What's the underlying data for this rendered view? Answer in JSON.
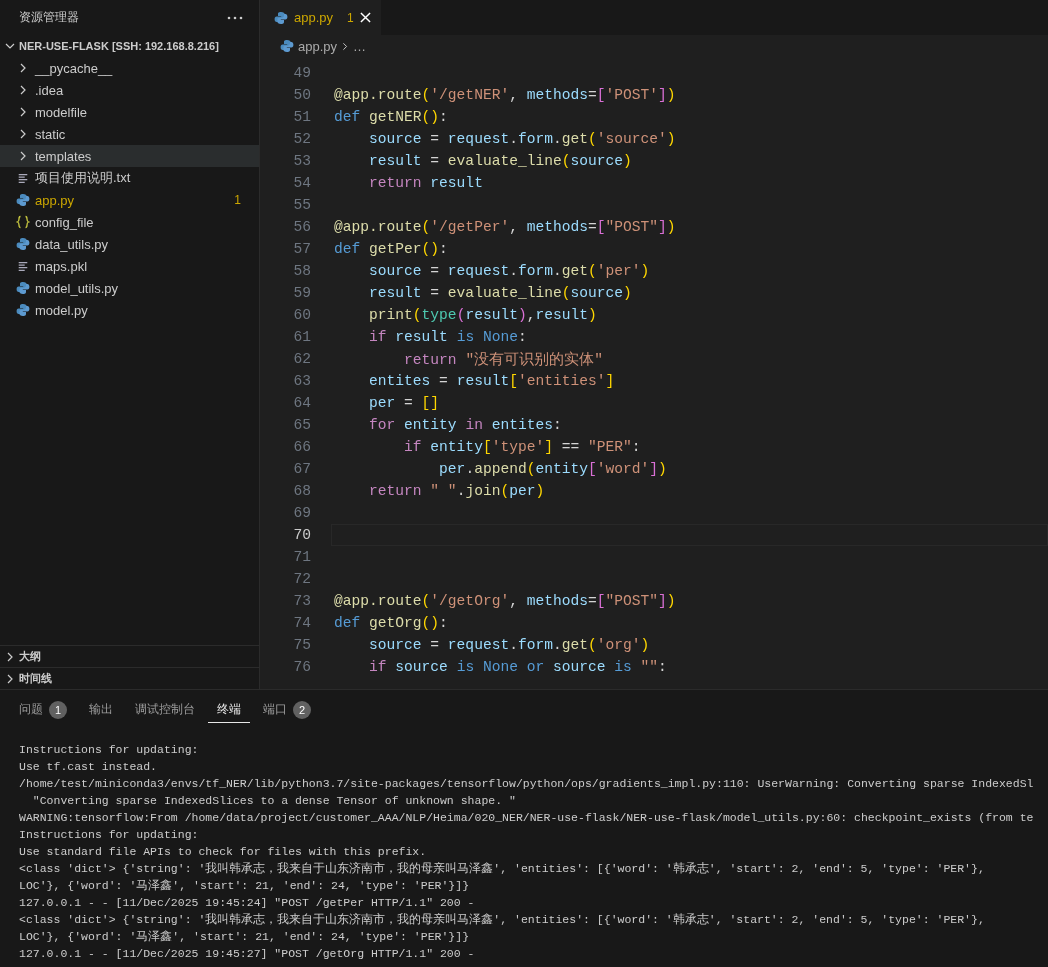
{
  "explorer": {
    "title": "资源管理器",
    "root": {
      "label": "NER-USE-FLASK [SSH: 192.168.8.216]",
      "expanded": true,
      "children": [
        {
          "label": "__pycache__",
          "kind": "folder",
          "expanded": false,
          "highlighted": false,
          "modified": false
        },
        {
          "label": ".idea",
          "kind": "folder",
          "expanded": false,
          "highlighted": false,
          "modified": false
        },
        {
          "label": "modelfile",
          "kind": "folder",
          "expanded": false,
          "highlighted": false,
          "modified": false
        },
        {
          "label": "static",
          "kind": "folder",
          "expanded": false,
          "highlighted": false,
          "modified": false
        },
        {
          "label": "templates",
          "kind": "folder",
          "expanded": false,
          "highlighted": true,
          "modified": false
        },
        {
          "label": "项目使用说明.txt",
          "kind": "text",
          "highlighted": false,
          "modified": false
        },
        {
          "label": "app.py",
          "kind": "python",
          "highlighted": false,
          "modified": true,
          "badge": "1"
        },
        {
          "label": "config_file",
          "kind": "json",
          "highlighted": false,
          "modified": false
        },
        {
          "label": "data_utils.py",
          "kind": "python",
          "highlighted": false,
          "modified": false
        },
        {
          "label": "maps.pkl",
          "kind": "text",
          "highlighted": false,
          "modified": false
        },
        {
          "label": "model_utils.py",
          "kind": "python",
          "highlighted": false,
          "modified": false
        },
        {
          "label": "model.py",
          "kind": "python",
          "highlighted": false,
          "modified": false
        }
      ]
    },
    "sections": [
      {
        "label": "大纲",
        "expanded": false
      },
      {
        "label": "时间线",
        "expanded": false
      }
    ]
  },
  "tabs": [
    {
      "label": "app.py",
      "badge": "1",
      "selected": true,
      "modified": true
    }
  ],
  "breadcrumb": {
    "file": "app.py",
    "more": "…"
  },
  "editor": {
    "lines": [
      {
        "number": "49",
        "current": false
      },
      {
        "number": "50",
        "current": false,
        "tokens": [
          {
            "t": "@app.route",
            "kind": "fn"
          },
          {
            "t": "(",
            "kind": "b1"
          },
          {
            "t": "'/getNER'",
            "kind": "str"
          },
          {
            "t": ", ",
            "kind": "p"
          },
          {
            "t": "methods",
            "kind": "var"
          },
          {
            "t": "=",
            "kind": "p"
          },
          {
            "t": "[",
            "kind": "b2"
          },
          {
            "t": "'POST'",
            "kind": "str"
          },
          {
            "t": "]",
            "kind": "b2"
          },
          {
            "t": ")",
            "kind": "b1"
          }
        ]
      },
      {
        "number": "51",
        "current": false,
        "tokens": [
          {
            "t": "def ",
            "kind": "bl"
          },
          {
            "t": "getNER",
            "kind": "fn"
          },
          {
            "t": "()",
            "kind": "b1"
          },
          {
            "t": ":",
            "kind": "p"
          }
        ]
      },
      {
        "number": "52",
        "current": false,
        "tokens": [
          {
            "t": "    source",
            "kind": "var"
          },
          {
            "t": " = ",
            "kind": "p"
          },
          {
            "t": "request",
            "kind": "var"
          },
          {
            "t": ".",
            "kind": "p"
          },
          {
            "t": "form",
            "kind": "var"
          },
          {
            "t": ".",
            "kind": "p"
          },
          {
            "t": "get",
            "kind": "fn"
          },
          {
            "t": "(",
            "kind": "b1"
          },
          {
            "t": "'source'",
            "kind": "str"
          },
          {
            "t": ")",
            "kind": "b1"
          }
        ]
      },
      {
        "number": "53",
        "current": false,
        "tokens": [
          {
            "t": "    result",
            "kind": "var"
          },
          {
            "t": " = ",
            "kind": "p"
          },
          {
            "t": "evaluate_line",
            "kind": "fn"
          },
          {
            "t": "(",
            "kind": "b1"
          },
          {
            "t": "source",
            "kind": "var"
          },
          {
            "t": ")",
            "kind": "b1"
          }
        ]
      },
      {
        "number": "54",
        "current": false,
        "tokens": [
          {
            "t": "    return ",
            "kind": "kw"
          },
          {
            "t": "result",
            "kind": "var"
          }
        ]
      },
      {
        "number": "55",
        "current": false
      },
      {
        "number": "56",
        "current": false,
        "tokens": [
          {
            "t": "@app.route",
            "kind": "fn"
          },
          {
            "t": "(",
            "kind": "b1"
          },
          {
            "t": "'/getPer'",
            "kind": "str"
          },
          {
            "t": ", ",
            "kind": "p"
          },
          {
            "t": "methods",
            "kind": "var"
          },
          {
            "t": "=",
            "kind": "p"
          },
          {
            "t": "[",
            "kind": "b2"
          },
          {
            "t": "\"POST\"",
            "kind": "str"
          },
          {
            "t": "]",
            "kind": "b2"
          },
          {
            "t": ")",
            "kind": "b1"
          }
        ]
      },
      {
        "number": "57",
        "current": false,
        "tokens": [
          {
            "t": "def ",
            "kind": "bl"
          },
          {
            "t": "getPer",
            "kind": "fn"
          },
          {
            "t": "()",
            "kind": "b1"
          },
          {
            "t": ":",
            "kind": "p"
          }
        ]
      },
      {
        "number": "58",
        "current": false,
        "tokens": [
          {
            "t": "    source",
            "kind": "var"
          },
          {
            "t": " = ",
            "kind": "p"
          },
          {
            "t": "request",
            "kind": "var"
          },
          {
            "t": ".",
            "kind": "p"
          },
          {
            "t": "form",
            "kind": "var"
          },
          {
            "t": ".",
            "kind": "p"
          },
          {
            "t": "get",
            "kind": "fn"
          },
          {
            "t": "(",
            "kind": "b1"
          },
          {
            "t": "'per'",
            "kind": "str"
          },
          {
            "t": ")",
            "kind": "b1"
          }
        ]
      },
      {
        "number": "59",
        "current": false,
        "tokens": [
          {
            "t": "    result",
            "kind": "var"
          },
          {
            "t": " = ",
            "kind": "p"
          },
          {
            "t": "evaluate_line",
            "kind": "fn"
          },
          {
            "t": "(",
            "kind": "b1"
          },
          {
            "t": "source",
            "kind": "var"
          },
          {
            "t": ")",
            "kind": "b1"
          }
        ]
      },
      {
        "number": "60",
        "current": false,
        "tokens": [
          {
            "t": "    print",
            "kind": "fn"
          },
          {
            "t": "(",
            "kind": "b1"
          },
          {
            "t": "type",
            "kind": "cls"
          },
          {
            "t": "(",
            "kind": "b2"
          },
          {
            "t": "result",
            "kind": "var"
          },
          {
            "t": ")",
            "kind": "b2"
          },
          {
            "t": ",",
            "kind": "p"
          },
          {
            "t": "result",
            "kind": "var"
          },
          {
            "t": ")",
            "kind": "b1"
          }
        ]
      },
      {
        "number": "61",
        "current": false,
        "tokens": [
          {
            "t": "    if ",
            "kind": "kw"
          },
          {
            "t": "result ",
            "kind": "var"
          },
          {
            "t": "is None",
            "kind": "bl"
          },
          {
            "t": ":",
            "kind": "p"
          }
        ]
      },
      {
        "number": "62",
        "current": false,
        "tokens": [
          {
            "t": "        return ",
            "kind": "kw"
          },
          {
            "t": "\"没有可识别的实体\"",
            "kind": "str"
          }
        ]
      },
      {
        "number": "63",
        "current": false,
        "tokens": [
          {
            "t": "    entites",
            "kind": "var"
          },
          {
            "t": " = ",
            "kind": "p"
          },
          {
            "t": "result",
            "kind": "var"
          },
          {
            "t": "[",
            "kind": "b1"
          },
          {
            "t": "'entities'",
            "kind": "str"
          },
          {
            "t": "]",
            "kind": "b1"
          }
        ]
      },
      {
        "number": "64",
        "current": false,
        "tokens": [
          {
            "t": "    per",
            "kind": "var"
          },
          {
            "t": " = ",
            "kind": "p"
          },
          {
            "t": "[]",
            "kind": "b1"
          }
        ]
      },
      {
        "number": "65",
        "current": false,
        "tokens": [
          {
            "t": "    for ",
            "kind": "kw"
          },
          {
            "t": "entity ",
            "kind": "var"
          },
          {
            "t": "in ",
            "kind": "kw"
          },
          {
            "t": "entites",
            "kind": "var"
          },
          {
            "t": ":",
            "kind": "p"
          }
        ]
      },
      {
        "number": "66",
        "current": false,
        "tokens": [
          {
            "t": "        if ",
            "kind": "kw"
          },
          {
            "t": "entity",
            "kind": "var"
          },
          {
            "t": "[",
            "kind": "b1"
          },
          {
            "t": "'type'",
            "kind": "str"
          },
          {
            "t": "]",
            "kind": "b1"
          },
          {
            "t": " == ",
            "kind": "p"
          },
          {
            "t": "\"PER\"",
            "kind": "str"
          },
          {
            "t": ":",
            "kind": "p"
          }
        ]
      },
      {
        "number": "67",
        "current": false,
        "tokens": [
          {
            "t": "            per",
            "kind": "var"
          },
          {
            "t": ".",
            "kind": "p"
          },
          {
            "t": "append",
            "kind": "fn"
          },
          {
            "t": "(",
            "kind": "b1"
          },
          {
            "t": "entity",
            "kind": "var"
          },
          {
            "t": "[",
            "kind": "b2"
          },
          {
            "t": "'word'",
            "kind": "str"
          },
          {
            "t": "]",
            "kind": "b2"
          },
          {
            "t": ")",
            "kind": "b1"
          }
        ]
      },
      {
        "number": "68",
        "current": false,
        "tokens": [
          {
            "t": "    return ",
            "kind": "kw"
          },
          {
            "t": "\" \"",
            "kind": "str"
          },
          {
            "t": ".",
            "kind": "p"
          },
          {
            "t": "join",
            "kind": "fn"
          },
          {
            "t": "(",
            "kind": "b1"
          },
          {
            "t": "per",
            "kind": "var"
          },
          {
            "t": ")",
            "kind": "b1"
          }
        ]
      },
      {
        "number": "69",
        "current": false
      },
      {
        "number": "70",
        "current": true
      },
      {
        "number": "71",
        "current": false
      },
      {
        "number": "72",
        "current": false
      },
      {
        "number": "73",
        "current": false,
        "tokens": [
          {
            "t": "@app.route",
            "kind": "fn"
          },
          {
            "t": "(",
            "kind": "b1"
          },
          {
            "t": "'/getOrg'",
            "kind": "str"
          },
          {
            "t": ", ",
            "kind": "p"
          },
          {
            "t": "methods",
            "kind": "var"
          },
          {
            "t": "=",
            "kind": "p"
          },
          {
            "t": "[",
            "kind": "b2"
          },
          {
            "t": "\"POST\"",
            "kind": "str"
          },
          {
            "t": "]",
            "kind": "b2"
          },
          {
            "t": ")",
            "kind": "b1"
          }
        ]
      },
      {
        "number": "74",
        "current": false,
        "tokens": [
          {
            "t": "def ",
            "kind": "bl"
          },
          {
            "t": "getOrg",
            "kind": "fn"
          },
          {
            "t": "()",
            "kind": "b1"
          },
          {
            "t": ":",
            "kind": "p"
          }
        ]
      },
      {
        "number": "75",
        "current": false,
        "tokens": [
          {
            "t": "    source",
            "kind": "var"
          },
          {
            "t": " = ",
            "kind": "p"
          },
          {
            "t": "request",
            "kind": "var"
          },
          {
            "t": ".",
            "kind": "p"
          },
          {
            "t": "form",
            "kind": "var"
          },
          {
            "t": ".",
            "kind": "p"
          },
          {
            "t": "get",
            "kind": "fn"
          },
          {
            "t": "(",
            "kind": "b1"
          },
          {
            "t": "'org'",
            "kind": "str"
          },
          {
            "t": ")",
            "kind": "b1"
          }
        ]
      },
      {
        "number": "76",
        "current": false,
        "tokens": [
          {
            "t": "    if ",
            "kind": "kw"
          },
          {
            "t": "source ",
            "kind": "var"
          },
          {
            "t": "is None or ",
            "kind": "bl"
          },
          {
            "t": "source ",
            "kind": "var"
          },
          {
            "t": "is ",
            "kind": "bl"
          },
          {
            "t": "\"\"",
            "kind": "str"
          },
          {
            "t": ":",
            "kind": "p"
          }
        ]
      }
    ]
  },
  "panel": {
    "tabs": [
      {
        "label": "问题",
        "badge": "1",
        "selected": false
      },
      {
        "label": "输出",
        "selected": false
      },
      {
        "label": "调试控制台",
        "selected": false
      },
      {
        "label": "终端",
        "selected": true
      },
      {
        "label": "端口",
        "badge": "2",
        "selected": false
      }
    ],
    "terminal": [
      "Instructions for updating:",
      "Use tf.cast instead.",
      "/home/test/miniconda3/envs/tf_NER/lib/python3.7/site-packages/tensorflow/python/ops/gradients_impl.py:110: UserWarning: Converting sparse IndexedSl",
      "  \"Converting sparse IndexedSlices to a dense Tensor of unknown shape. \"",
      "WARNING:tensorflow:From /home/data/project/customer_AAA/NLP/Heima/020_NER/NER-use-flask/NER-use-flask/model_utils.py:60: checkpoint_exists (from te",
      "Instructions for updating:",
      "Use standard file APIs to check for files with this prefix.",
      "<class 'dict'> {'string': '我叫韩承志，我来自于山东济南市，我的母亲叫马泽鑫', 'entities': [{'word': '韩承志', 'start': 2, 'end': 5, 'type': 'PER'},",
      "LOC'}, {'word': '马泽鑫', 'start': 21, 'end': 24, 'type': 'PER'}]}",
      "127.0.0.1 - - [11/Dec/2025 19:45:24] \"POST /getPer HTTP/1.1\" 200 -",
      "<class 'dict'> {'string': '我叫韩承志，我来自于山东济南市，我的母亲叫马泽鑫', 'entities': [{'word': '韩承志', 'start': 2, 'end': 5, 'type': 'PER'},",
      "LOC'}, {'word': '马泽鑫', 'start': 21, 'end': 24, 'type': 'PER'}]}",
      "127.0.0.1 - - [11/Dec/2025 19:45:27] \"POST /getOrg HTTP/1.1\" 200 -"
    ]
  }
}
